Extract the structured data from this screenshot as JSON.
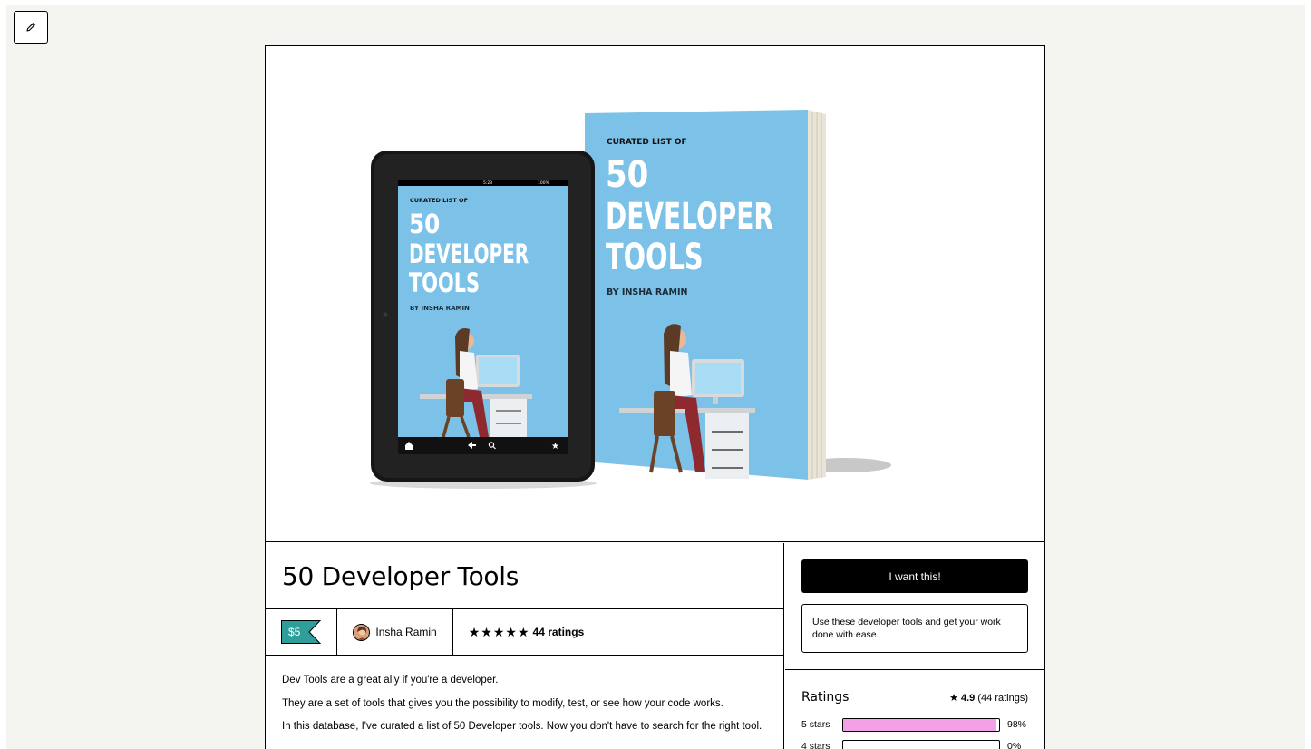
{
  "toolbar": {
    "edit_icon": "pencil-icon"
  },
  "cover": {
    "tablet": {
      "eyebrow": "CURATED LIST OF",
      "line1": "50",
      "line2": "DEVELOPER",
      "line3": "TOOLS",
      "byline": "BY INSHA RAMIN",
      "status_time": "5:23",
      "status_battery": "100%"
    },
    "book": {
      "eyebrow": "CURATED LIST OF",
      "line1": "50",
      "line2": "DEVELOPER",
      "line3": "TOOLS",
      "byline": "BY INSHA RAMIN"
    }
  },
  "product": {
    "title": "50 Developer Tools",
    "price": "$5",
    "author": "Insha Ramin",
    "rating_stars": 5,
    "ratings_label": "44 ratings",
    "description": [
      "Dev Tools are a great ally if you're a developer.",
      "They are a set of tools that gives you the possibility to modify, test, or see how your code works.",
      "In this database, I've curated a list of 50 Developer tools. Now you don't have to search for the right tool."
    ]
  },
  "purchase": {
    "button_label": "I want this!",
    "summary": "Use these developer tools and get your work done with ease."
  },
  "ratings": {
    "title": "Ratings",
    "average": "4.9",
    "count_label": "(44 ratings)",
    "breakdown": [
      {
        "label": "5 stars",
        "percent": 98,
        "percent_label": "98%"
      },
      {
        "label": "4 stars",
        "percent": 0,
        "percent_label": "0%"
      }
    ]
  },
  "colors": {
    "page_bg": "#f4f4f0",
    "price_tag": "#2f9e9a",
    "rating_bar": "#f3a0e6",
    "cover_blue": "#7cc1e8",
    "button": "#000000"
  }
}
